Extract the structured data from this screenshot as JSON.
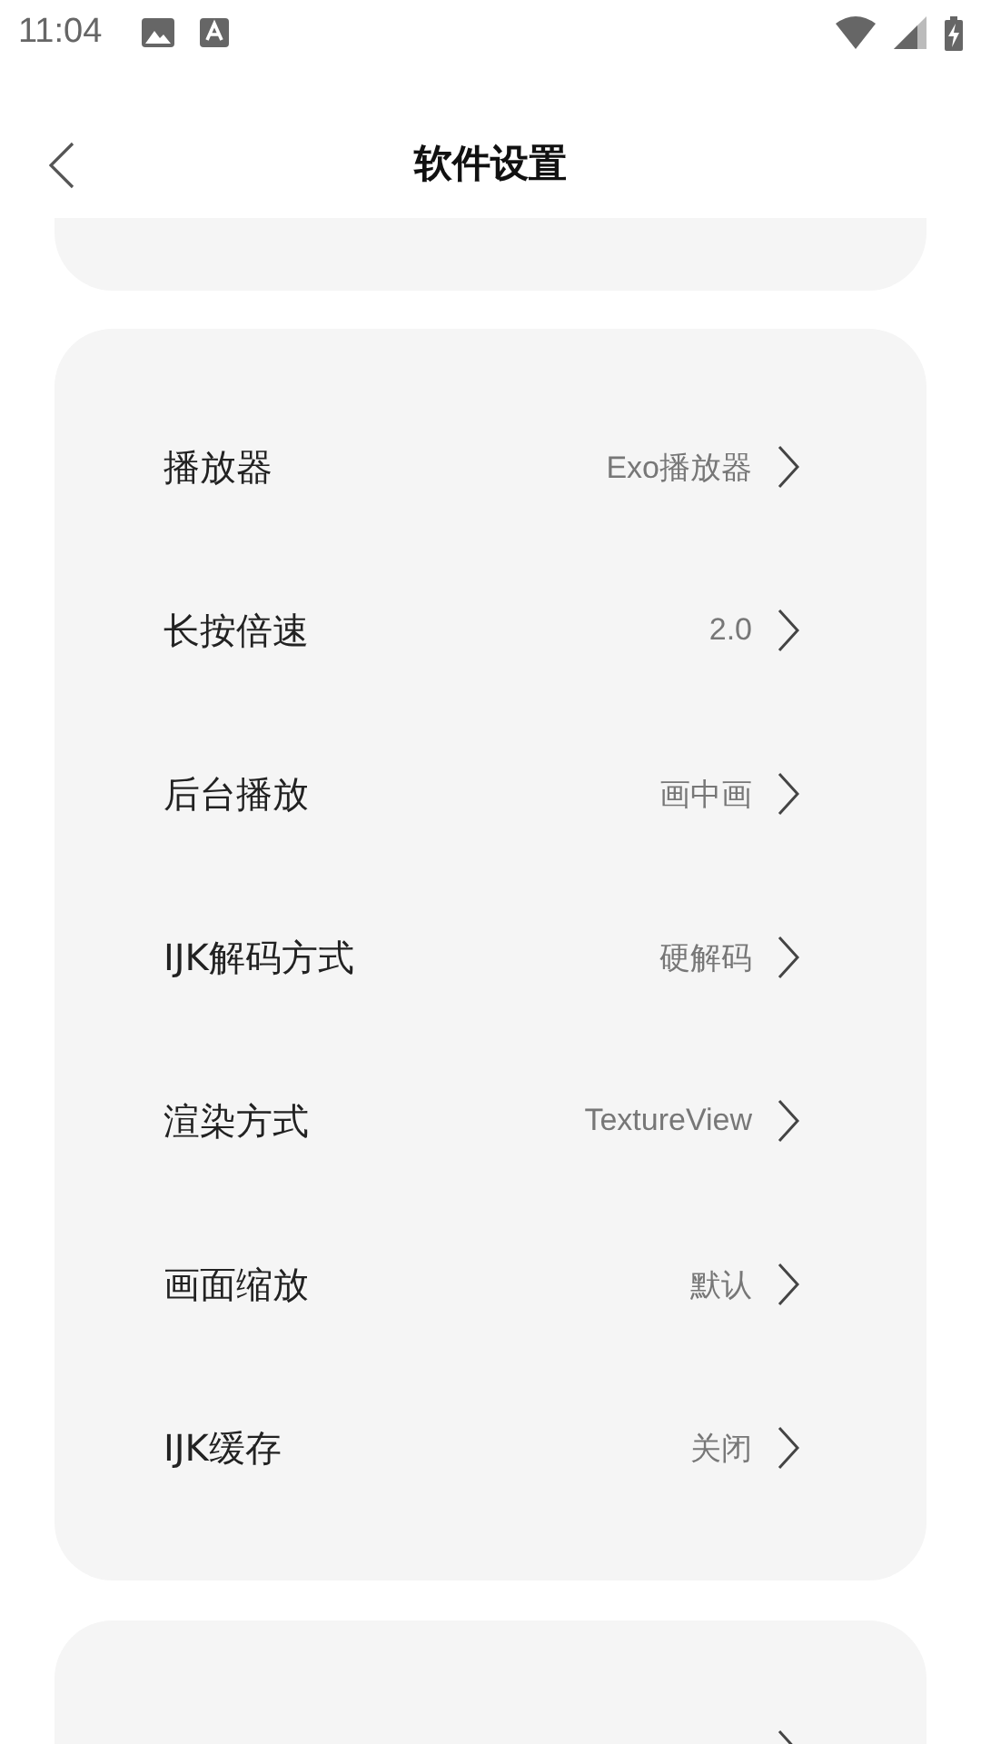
{
  "status_bar": {
    "time": "11:04"
  },
  "header": {
    "title": "软件设置"
  },
  "settings": [
    {
      "label": "播放器",
      "value": "Exo播放器"
    },
    {
      "label": "长按倍速",
      "value": "2.0"
    },
    {
      "label": "后台播放",
      "value": "画中画"
    },
    {
      "label": "IJK解码方式",
      "value": "硬解码"
    },
    {
      "label": "渲染方式",
      "value": "TextureView"
    },
    {
      "label": "画面缩放",
      "value": "默认"
    },
    {
      "label": "IJK缓存",
      "value": "关闭"
    }
  ]
}
